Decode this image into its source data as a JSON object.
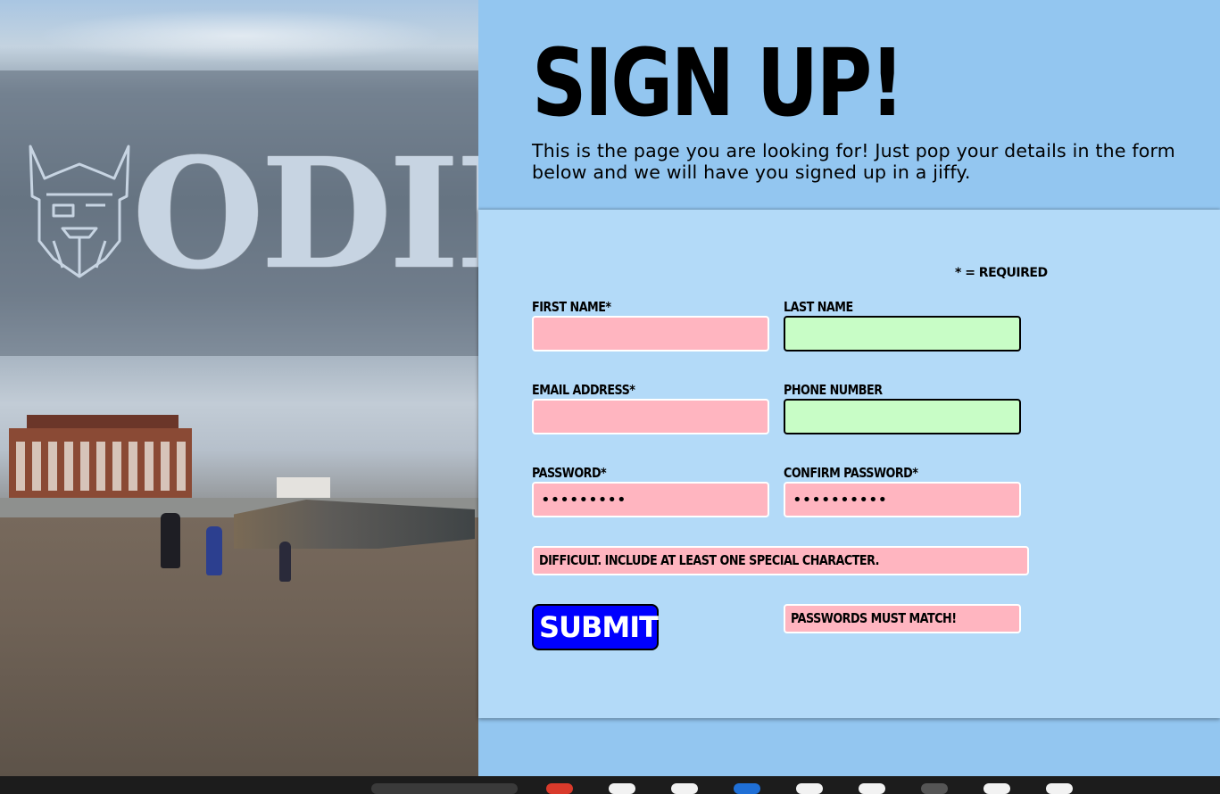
{
  "brand": {
    "logo_text": "ODIN",
    "logo_icon": "viking-helmet-icon"
  },
  "page": {
    "title": "Sign Up!",
    "intro": "This is the page you are looking for! Just pop your details in the form below and we will have you signed up in a jiffy."
  },
  "form": {
    "required_note": "* = Required",
    "first_name": {
      "label": "First Name*",
      "value": ""
    },
    "last_name": {
      "label": "Last Name",
      "value": ""
    },
    "email": {
      "label": "Email Address*",
      "value": ""
    },
    "phone": {
      "label": "Phone Number",
      "value": ""
    },
    "password": {
      "label": "Password*",
      "value": "•••••••••"
    },
    "confirm_password": {
      "label": "Confirm Password*",
      "value": "••••••••••"
    },
    "password_hint": "Difficult. Include at least one special character.",
    "submit_label": "Submit",
    "match_warning": "Passwords must match!"
  },
  "colors": {
    "page_bg": "#93c6f0",
    "form_bg": "#b3daf8",
    "required_field": "#ffb5c0",
    "optional_field": "#c8fdc6",
    "submit_button": "#0000ff"
  }
}
